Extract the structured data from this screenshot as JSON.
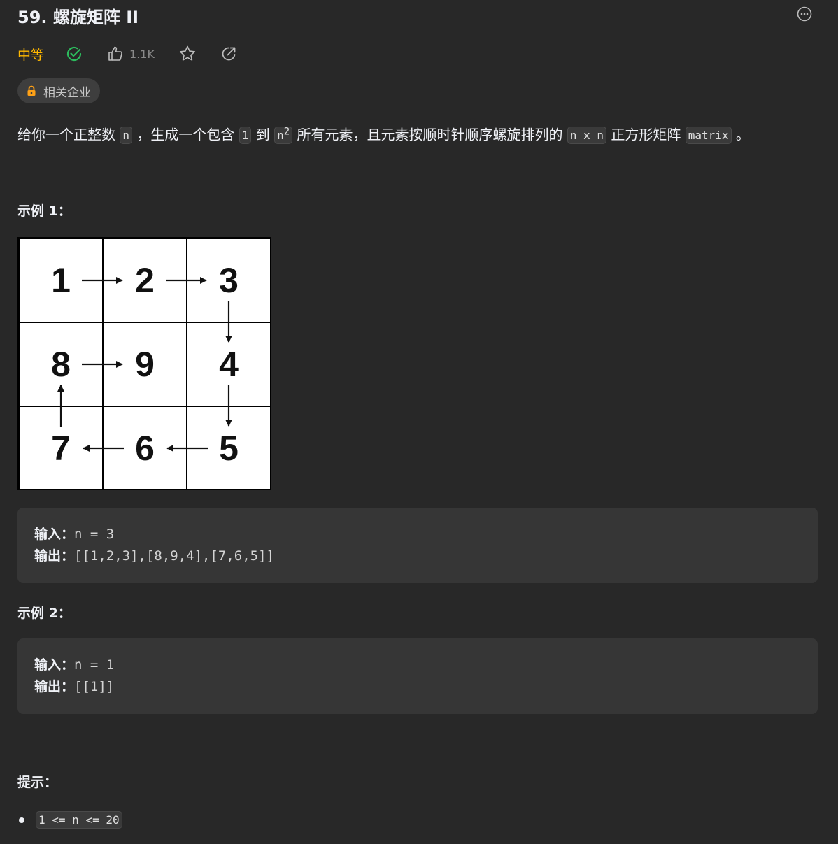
{
  "header": {
    "title": "59. 螺旋矩阵 II",
    "difficulty": "中等",
    "like_count": "1.1K",
    "company_tag": "相关企业"
  },
  "description": {
    "p1": "给你一个正整数 ",
    "code_n": "n",
    "p2": " ，生成一个包含 ",
    "code_1": "1",
    "p3": " 到 ",
    "code_n2_base": "n",
    "code_n2_sup": "2",
    "p4": " 所有元素，且元素按顺时针顺序螺旋排列的 ",
    "code_nxn": "n x n",
    "p5": " 正方形矩阵 ",
    "code_matrix": "matrix",
    "p6": " 。"
  },
  "example1": {
    "title": "示例 1：",
    "grid": [
      "1",
      "2",
      "3",
      "8",
      "9",
      "4",
      "7",
      "6",
      "5"
    ],
    "input_label": "输入：",
    "input_value": "n = 3",
    "output_label": "输出：",
    "output_value": "[[1,2,3],[8,9,4],[7,6,5]]"
  },
  "example2": {
    "title": "示例 2：",
    "input_label": "输入：",
    "input_value": "n = 1",
    "output_label": "输出：",
    "output_value": "[[1]]"
  },
  "hints": {
    "title": "提示：",
    "items": [
      "1 <= n <= 20"
    ]
  },
  "colors": {
    "background": "#282828",
    "difficulty_medium": "#ffb800",
    "solved_green": "#2cbb5d",
    "lock_orange": "#ffa116"
  },
  "icons": [
    "more-icon",
    "solved-check-icon",
    "thumbs-up-icon",
    "star-icon",
    "share-icon",
    "lock-icon"
  ]
}
